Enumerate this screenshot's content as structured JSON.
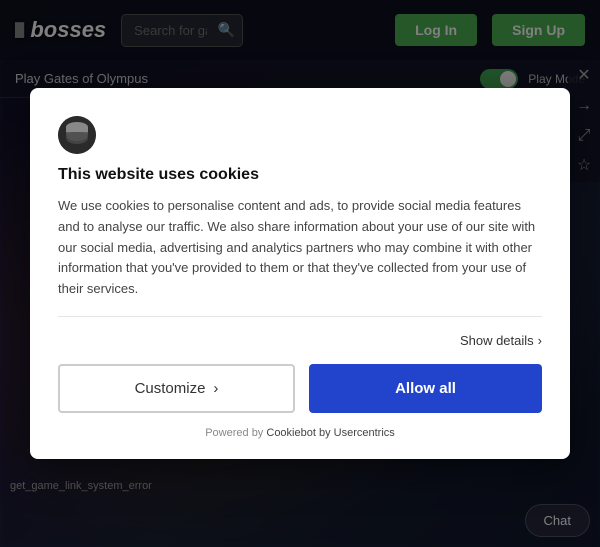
{
  "navbar": {
    "logo": "bosses",
    "search_placeholder": "Search for games",
    "login_label": "Log In",
    "signup_label": "Sign Up"
  },
  "play_bar": {
    "title": "Play Gates of Olympus",
    "play_mode_label": "Play Mode"
  },
  "side_icons": {
    "arrow_right": "→",
    "expand": "⤢",
    "star": "☆",
    "close": "✕"
  },
  "cookie_dialog": {
    "title": "This website uses cookies",
    "body": "We use cookies to personalise content and ads, to provide social media features and to analyse our traffic. We also share information about your use of our site with our social media, advertising and analytics partners who may combine it with other information that you've provided to them or that they've collected from your use of their services.",
    "show_details_label": "Show details",
    "customize_label": "Customize",
    "allow_all_label": "Allow all",
    "footer_powered": "Powered by",
    "footer_brand": "Cookiebot by Usercentrics"
  },
  "error_text": "get_game_link_system_error",
  "chat_label": "Chat"
}
